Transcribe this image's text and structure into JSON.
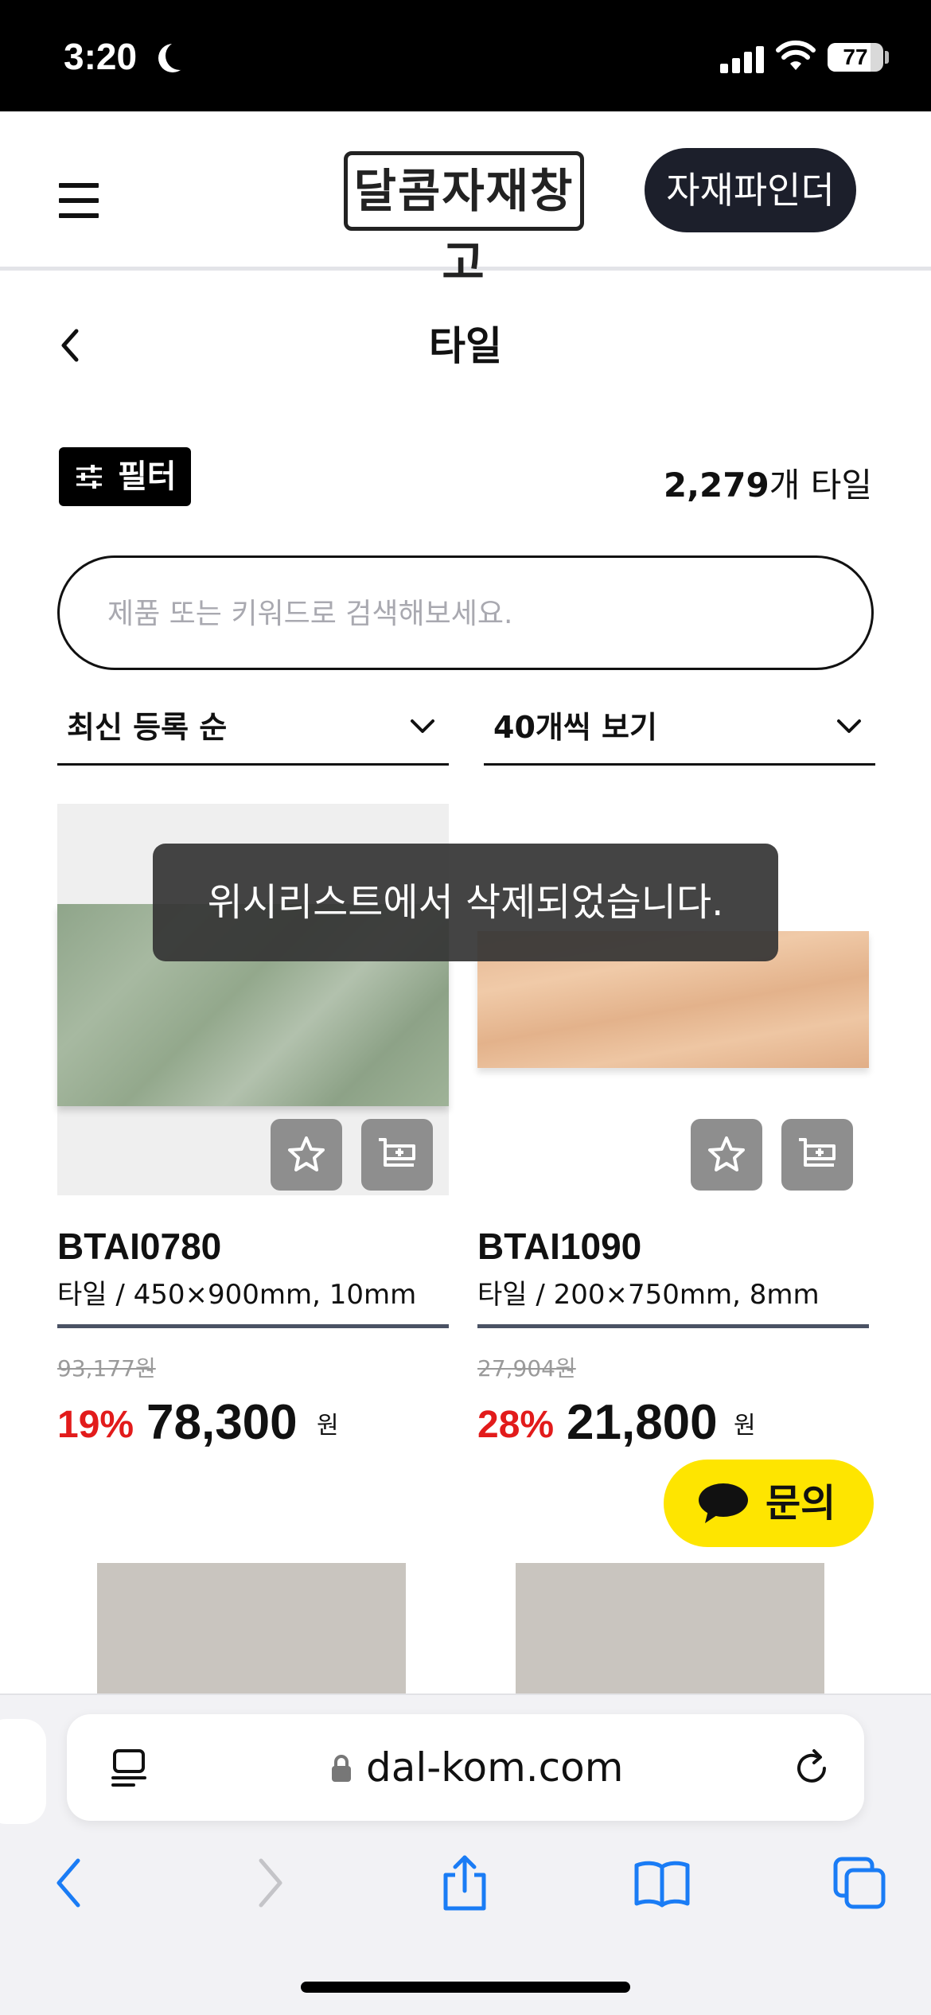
{
  "status_bar": {
    "time": "3:20",
    "battery": "77",
    "battery_level": 0.77
  },
  "header": {
    "logo_text": "달콤자재창고",
    "finder_button": "자재파인더"
  },
  "page": {
    "title": "타일"
  },
  "toolbar": {
    "filter_label": "필터",
    "count_number": "2,279",
    "count_suffix": "개 타일"
  },
  "search": {
    "placeholder": "제품 또는 키워드로 검색해보세요.",
    "value": ""
  },
  "sort": {
    "selected": "최신 등록 순"
  },
  "per_page": {
    "selected": "40개씩 보기"
  },
  "products": [
    {
      "name": "BTAI0780",
      "spec": "타일 / 450×900mm, 10mm",
      "original_price": "93,177원",
      "discount": "19%",
      "price": "78,300",
      "currency": "원"
    },
    {
      "name": "BTAI1090",
      "spec": "타일 / 200×750mm, 8mm",
      "original_price": "27,904원",
      "discount": "28%",
      "price": "21,800",
      "currency": "원"
    }
  ],
  "toast": {
    "message": "위시리스트에서 삭제되었습니다."
  },
  "kakao": {
    "label": "문의"
  },
  "browser": {
    "url": "dal-kom.com"
  },
  "colors": {
    "discount": "#e21b1b",
    "kakao": "#fee500",
    "finder_bg": "#1c1f2b",
    "safari_blue": "#1a7cf5"
  },
  "icons": [
    "moon-icon",
    "cellular-signal-icon",
    "wifi-icon",
    "battery-icon",
    "hamburger-menu-icon",
    "back-chevron-icon",
    "filter-sliders-icon",
    "chevron-down-icon",
    "star-icon",
    "add-to-cart-icon",
    "chat-bubble-icon",
    "reader-icon",
    "lock-icon",
    "reload-icon",
    "back-arrow-icon",
    "forward-arrow-icon",
    "share-icon",
    "bookmarks-icon",
    "tabs-icon"
  ]
}
